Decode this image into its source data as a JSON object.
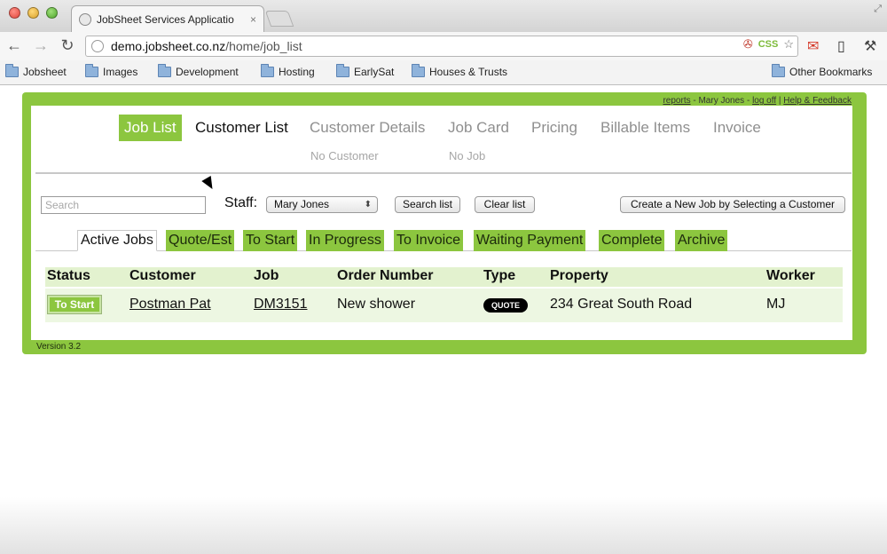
{
  "browser": {
    "tab_title": "JobSheet Services Applicatio",
    "tab_close": "×",
    "url_host": "demo.jobsheet.co.nz",
    "url_path": "/home/job_list",
    "css_badge": "CSS",
    "bookmarks": [
      "Jobsheet",
      "Images",
      "Development",
      "Hosting",
      "EarlySat",
      "Houses & Trusts"
    ],
    "other_bookmarks": "Other Bookmarks"
  },
  "header": {
    "reports": "reports",
    "user_sep": " - Mary Jones - ",
    "logoff": "log off",
    "pipe": " | ",
    "help": "Help & Feedback"
  },
  "mainnav": {
    "job_list": "Job List",
    "customer_list": "Customer List",
    "customer_details": "Customer Details",
    "job_card": "Job Card",
    "pricing": "Pricing",
    "billable_items": "Billable Items",
    "invoice": "Invoice",
    "no_customer": "No Customer",
    "no_job": "No Job"
  },
  "filters": {
    "search_placeholder": "Search",
    "staff_label": "Staff:",
    "staff_selected": "Mary Jones",
    "search_list": "Search list",
    "clear_list": "Clear list",
    "create_job": "Create a New Job by Selecting a Customer"
  },
  "job_tabs": [
    "Active Jobs",
    "Quote/Est",
    "To Start",
    "In Progress",
    "To Invoice",
    "Waiting Payment",
    "Complete",
    "Archive"
  ],
  "table": {
    "headers": [
      "Status",
      "Customer",
      "Job",
      "Order Number",
      "Type",
      "Property",
      "Worker"
    ],
    "rows": [
      {
        "status": "To Start",
        "customer": "Postman Pat",
        "job": "DM3151",
        "order_number": "New shower",
        "type": "QUOTE",
        "property": "234 Great South Road",
        "worker": "MJ"
      }
    ]
  },
  "footer": {
    "version": "Version 3.2"
  },
  "colors": {
    "accent": "#8cc63f",
    "header_row": "#e3f2cf",
    "body_row": "#edf7e2"
  }
}
